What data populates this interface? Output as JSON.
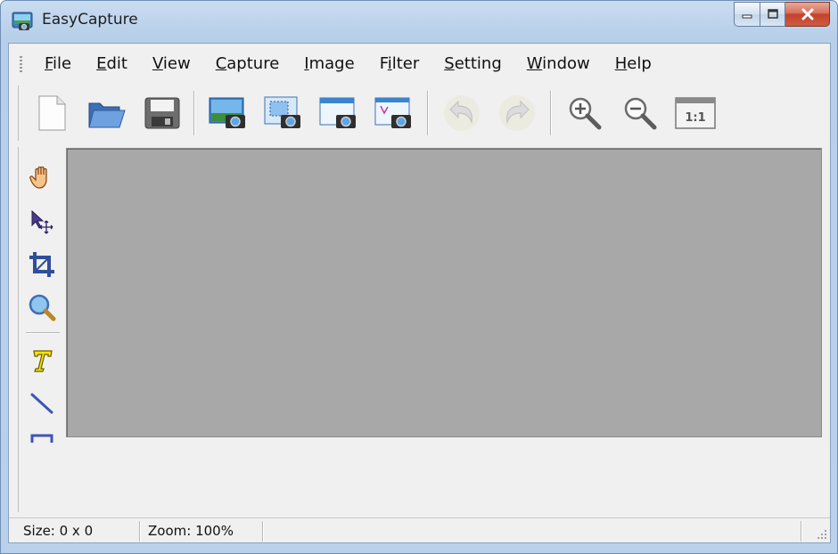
{
  "window": {
    "title": "EasyCapture",
    "icon": "easycapture-app-icon"
  },
  "caption_buttons": [
    "minimize-icon",
    "maximize-icon",
    "close-icon"
  ],
  "menu": [
    {
      "label": "File",
      "mnemonic": "F"
    },
    {
      "label": "Edit",
      "mnemonic": "E"
    },
    {
      "label": "View",
      "mnemonic": "V"
    },
    {
      "label": "Capture",
      "mnemonic": "C"
    },
    {
      "label": "Image",
      "mnemonic": "I"
    },
    {
      "label": "Filter",
      "mnemonic": "i"
    },
    {
      "label": "Setting",
      "mnemonic": "S"
    },
    {
      "label": "Window",
      "mnemonic": "W"
    },
    {
      "label": "Help",
      "mnemonic": "H"
    }
  ],
  "toolbar": {
    "buttons": [
      "new-file-icon",
      "open-folder-icon",
      "save-disk-icon",
      "capture-fullscreen-icon",
      "capture-region-icon",
      "capture-window-icon",
      "capture-freehand-icon",
      "undo-icon",
      "redo-icon",
      "zoom-in-icon",
      "zoom-out-icon",
      "actual-size-icon"
    ],
    "actual_size_label": "1:1"
  },
  "tools": [
    "hand-pan-icon",
    "move-select-icon",
    "crop-icon",
    "magnifier-icon",
    "text-tool-icon",
    "line-tool-icon",
    "rectangle-tool-icon"
  ],
  "canvas": {
    "background": "#a8a8a8"
  },
  "status": {
    "size": "Size: 0 x 0",
    "zoom": "Zoom: 100%"
  }
}
